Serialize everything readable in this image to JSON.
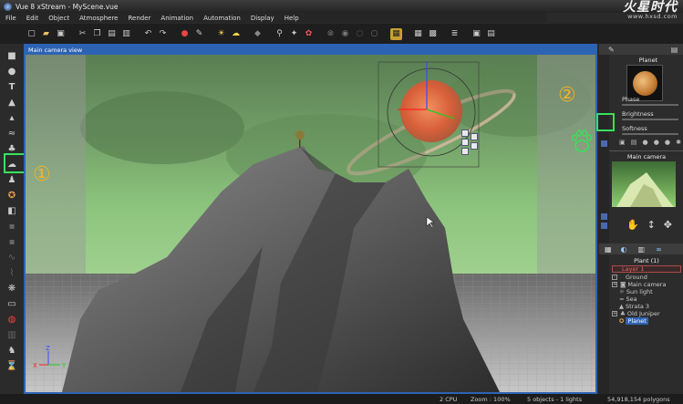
{
  "window": {
    "title": "Vue 8 xStream - MyScene.vue"
  },
  "logo": {
    "main": "火星时代",
    "url": "www.hxsd.com"
  },
  "menu": [
    "File",
    "Edit",
    "Object",
    "Atmosphere",
    "Render",
    "Animation",
    "Automation",
    "Display",
    "Help"
  ],
  "viewport": {
    "title": "Main camera view"
  },
  "annotations": {
    "left": "①",
    "right": "②"
  },
  "right_panel": {
    "object_panel_title": "Planet",
    "sliders": [
      "Phase",
      "Brightness",
      "Softness"
    ],
    "camera_panel_title": "Main camera",
    "layers_title": "Plant (1)",
    "tree": [
      {
        "label": "Layer 1",
        "selected": false,
        "highlighted": true
      },
      {
        "label": "Ground",
        "selected": false
      },
      {
        "label": "Main camera",
        "selected": false
      },
      {
        "label": "Sun light",
        "selected": false
      },
      {
        "label": "Sea",
        "selected": false
      },
      {
        "label": "Strata 3",
        "selected": false
      },
      {
        "label": "Old Juniper",
        "selected": false
      },
      {
        "label": "Planet",
        "selected": true
      }
    ]
  },
  "status": {
    "cpu": "2 CPU",
    "zoom": "Zoom : 100%",
    "objects": "5 objects - 1 lights",
    "polygons": "54,918,154 polygons"
  },
  "colors": {
    "viewport_border": "#2d63b4",
    "highlight_green": "#37e25a",
    "annotation": "#f0b428",
    "sky": "#6fa063",
    "planet": "#e0683a"
  }
}
